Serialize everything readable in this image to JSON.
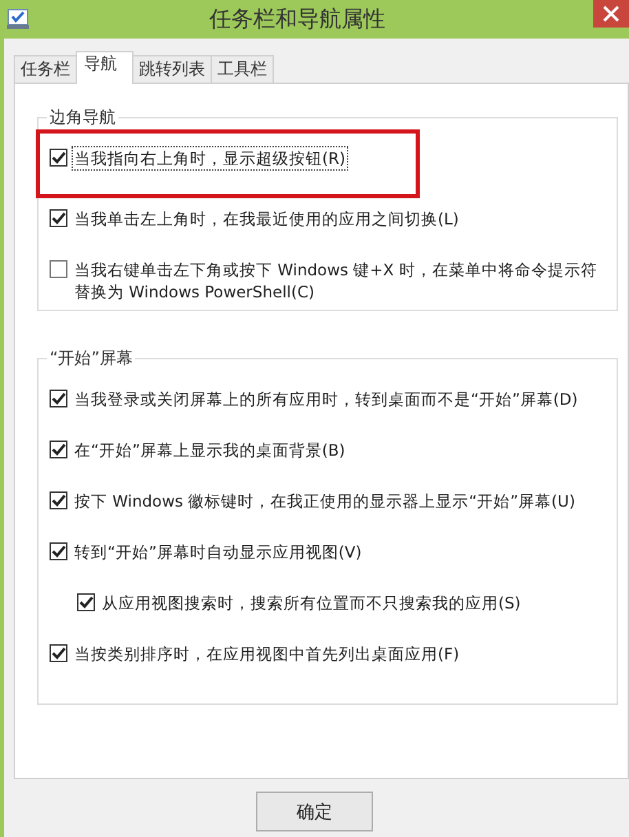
{
  "window": {
    "title": "任务栏和导航属性"
  },
  "tabs": [
    {
      "label": "任务栏",
      "selected": false
    },
    {
      "label": "导航",
      "selected": true
    },
    {
      "label": "跳转列表",
      "selected": false
    },
    {
      "label": "工具栏",
      "selected": false
    }
  ],
  "groups": [
    {
      "title": "边角导航",
      "options": [
        {
          "label": "当我指向右上角时，显示超级按钮(R)",
          "checked": true,
          "focused": true,
          "highlighted": true
        },
        {
          "label": "当我单击左上角时，在我最近使用的应用之间切换(L)",
          "checked": true,
          "focused": false,
          "highlighted": false
        },
        {
          "label": "当我右键单击左下角或按下 Windows 键+X 时，在菜单中将命令提示符替换为 Windows PowerShell(C)",
          "checked": false,
          "focused": false,
          "highlighted": false
        }
      ]
    },
    {
      "title": "“开始”屏幕",
      "options": [
        {
          "label": "当我登录或关闭屏幕上的所有应用时，转到桌面而不是“开始”屏幕(D)",
          "checked": true,
          "focused": false,
          "highlighted": false
        },
        {
          "label": "在“开始”屏幕上显示我的桌面背景(B)",
          "checked": true,
          "focused": false,
          "highlighted": false
        },
        {
          "label": "按下 Windows 徽标键时，在我正使用的显示器上显示“开始”屏幕(U)",
          "checked": true,
          "focused": false,
          "highlighted": false
        },
        {
          "label": "转到“开始”屏幕时自动显示应用视图(V)",
          "checked": true,
          "focused": false,
          "highlighted": false,
          "children": [
            {
              "label": "从应用视图搜索时，搜索所有位置而不只搜索我的应用(S)",
              "checked": true,
              "focused": false,
              "highlighted": false
            }
          ]
        },
        {
          "label": "当按类别排序时，在应用视图中首先列出桌面应用(F)",
          "checked": true,
          "focused": false,
          "highlighted": false
        }
      ]
    }
  ],
  "buttons": [
    "确定"
  ]
}
